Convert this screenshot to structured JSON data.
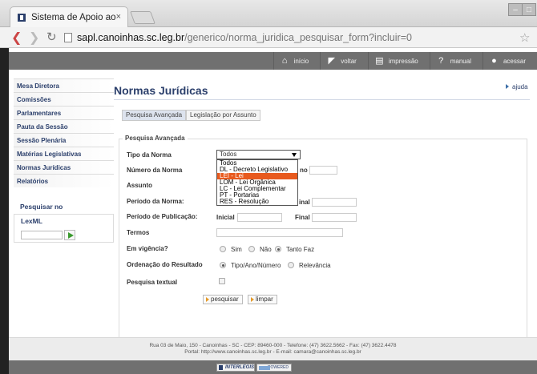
{
  "browser": {
    "tab_title": "Sistema de Apoio ao",
    "tab_close": "×",
    "url_host": "sapl.canoinhas.sc.leg.br",
    "url_path": "/generico/norma_juridica_pesquisar_form?incluir=0",
    "icons": [
      "back-icon",
      "forward-icon",
      "reload-icon",
      "page-icon",
      "star-icon"
    ]
  },
  "site_nav": {
    "items": [
      {
        "label": "início",
        "icon": "home-icon",
        "glyph": "⌂"
      },
      {
        "label": "voltar",
        "icon": "back-arrow-icon",
        "glyph": "◤"
      },
      {
        "label": "impressão",
        "icon": "print-icon",
        "glyph": "▤"
      },
      {
        "label": "manual",
        "icon": "manual-icon",
        "glyph": "?"
      },
      {
        "label": "acessar",
        "icon": "user-icon",
        "glyph": "●"
      }
    ]
  },
  "sidebar": {
    "items": [
      {
        "label": "Mesa Diretora"
      },
      {
        "label": "Comissões"
      },
      {
        "label": "Parlamentares"
      },
      {
        "label": "Pauta da Sessão"
      },
      {
        "label": "Sessão Plenária"
      },
      {
        "label": "Matérias Legislativas"
      },
      {
        "label": "Normas Jurídicas"
      },
      {
        "label": "Relatórios"
      }
    ],
    "search_label": "Pesquisar no",
    "lexml_label": "LexML"
  },
  "main": {
    "title": "Normas Jurídicas",
    "help_label": "ajuda",
    "tabs": [
      "Pesquisa Avançada",
      "Legislação por Assunto"
    ],
    "legend": "Pesquisa Avançada",
    "labels": {
      "tipo": "Tipo da Norma",
      "numero": "Número da Norma",
      "ano": "no",
      "assunto": "Assunto",
      "periodo_norma": "Período da Norma:",
      "final1": "inal",
      "periodo_pub": "Período de Publicação:",
      "inicial": "Inicial",
      "final2": "Final",
      "termos": "Termos",
      "vigencia": "Em vigência?",
      "ordenacao": "Ordenação do Resultado",
      "textual": "Pesquisa textual"
    },
    "select_value": "Todos",
    "dropdown_options": [
      "Todos",
      "DL - Decreto Legislativo",
      "LEI - Lei",
      "LOM - Lei Orgânica",
      "LC - Lei Complementar",
      "PT - Portarias",
      "RES - Resolução"
    ],
    "selected_option_index": 2,
    "vigencia_options": [
      "Sim",
      "Não",
      "Tanto Faz"
    ],
    "vigencia_selected": "Tanto Faz",
    "ordenacao_options": [
      "Tipo/Ano/Número",
      "Relevância"
    ],
    "ordenacao_selected": "Tipo/Ano/Número",
    "buttons": {
      "search": "pesquisar",
      "clear": "limpar"
    }
  },
  "footer": {
    "line1": "Rua 03 de Maio, 150 - Canoinhas - SC - CEP: 89460-000 - Telefone: (47) 3622.5662 - Fax: (47) 3622.4478",
    "line2": "Portal: http://www.canoinhas.sc.leg.br - E-mail: camara@canoinhas.sc.leg.br",
    "logo1": "INTERLEGIS",
    "logo2": "POWERED"
  }
}
